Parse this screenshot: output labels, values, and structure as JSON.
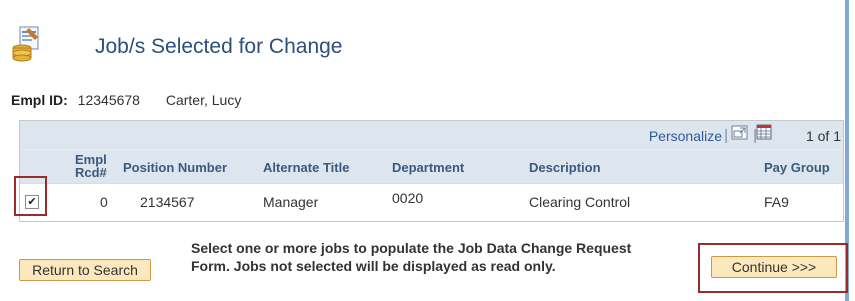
{
  "page": {
    "title": "Job/s Selected for Change"
  },
  "employee": {
    "id_label": "Empl ID:",
    "id_value": "12345678",
    "name": "Carter, Lucy"
  },
  "grid": {
    "personalize_label": "Personalize",
    "separator": "|",
    "page_info": "1 of 1",
    "columns": {
      "empl_rcd_line1": "Empl",
      "empl_rcd_line2": "Rcd#",
      "position_number": "Position Number",
      "alternate_title": "Alternate Title",
      "department": "Department",
      "description": "Description",
      "pay_group": "Pay Group"
    },
    "rows": [
      {
        "selected": true,
        "checkbox_mark": "✔",
        "empl_rcd": "0",
        "position_number": "2134567",
        "alternate_title": "Manager",
        "department": "0020",
        "description": "Clearing Control",
        "pay_group": "FA9"
      }
    ]
  },
  "buttons": {
    "return_label": "Return to Search",
    "continue_label": "Continue >>>"
  },
  "instruction": {
    "line1": "Select one or more jobs to populate the Job Data Change Request",
    "line2": "Form.  Jobs not selected will be displayed as read only."
  },
  "colors": {
    "title": "#2d4f7c",
    "header_bg": "#dde6ef",
    "button_bg": "#fce8bd",
    "highlight": "#9b2b2b",
    "link": "#2c5a9a"
  },
  "icons": [
    "job-documents-icon",
    "zoom-icon",
    "download-grid-icon",
    "checkbox-checked-icon"
  ]
}
